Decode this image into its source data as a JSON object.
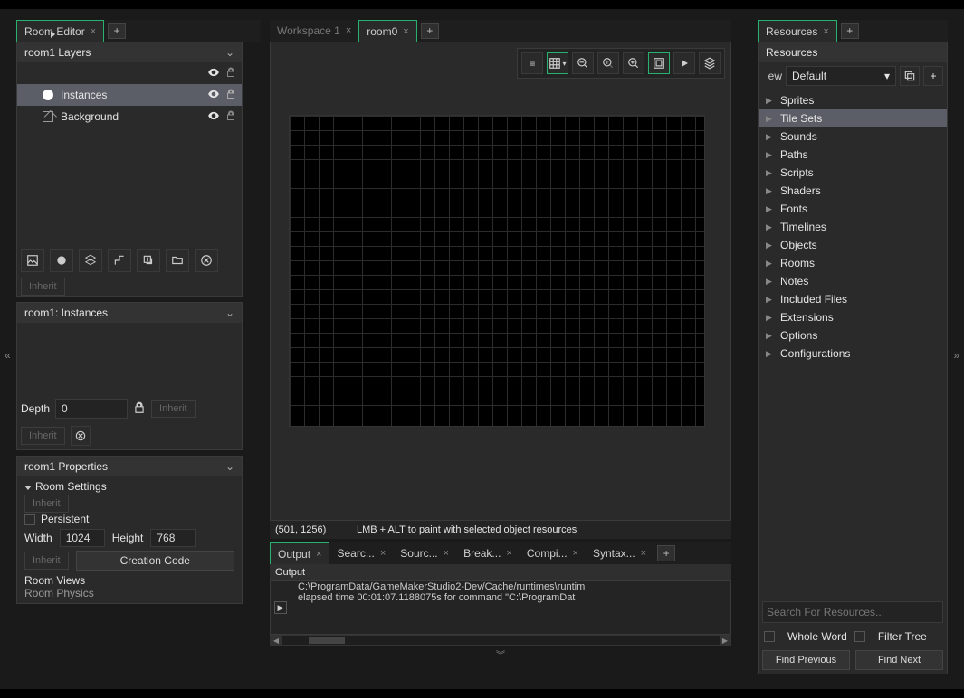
{
  "left": {
    "tab": "Room Editor",
    "layers_header": "room1 Layers",
    "layers": [
      {
        "label": "Instances",
        "selected": true
      },
      {
        "label": "Background",
        "selected": false
      }
    ],
    "inherit": "Inherit",
    "instances_header": "room1: Instances",
    "depth_label": "Depth",
    "depth_value": "0",
    "props_header": "room1 Properties",
    "room_settings": "Room Settings",
    "persistent": "Persistent",
    "width_label": "Width",
    "width_value": "1024",
    "height_label": "Height",
    "height_value": "768",
    "creation_code": "Creation Code",
    "room_views": "Room Views",
    "room_physics": "Room Physics"
  },
  "center": {
    "tabs": [
      {
        "label": "Workspace 1",
        "dim": true
      },
      {
        "label": "room0",
        "active": true
      }
    ],
    "coord": "(501, 1256)",
    "hint": "LMB + ALT to paint with selected object resources",
    "output_tabs": [
      {
        "label": "Output",
        "active": true
      },
      {
        "label": "Searc...",
        "active": false
      },
      {
        "label": "Sourc...",
        "active": false
      },
      {
        "label": "Break...",
        "active": false
      },
      {
        "label": "Compi...",
        "active": false
      },
      {
        "label": "Syntax...",
        "active": false
      }
    ],
    "output_title": "Output",
    "output_lines": [
      "C:\\ProgramData/GameMakerStudio2-Dev/Cache/runtimes\\runtim",
      "elapsed time 00:01:07.1188075s for command \"C:\\ProgramDat"
    ]
  },
  "right": {
    "tab": "Resources",
    "title": "Resources",
    "view_abbr": "ew",
    "selector": "Default",
    "tree": [
      {
        "label": "Sprites"
      },
      {
        "label": "Tile Sets",
        "selected": true
      },
      {
        "label": "Sounds"
      },
      {
        "label": "Paths"
      },
      {
        "label": "Scripts"
      },
      {
        "label": "Shaders"
      },
      {
        "label": "Fonts"
      },
      {
        "label": "Timelines"
      },
      {
        "label": "Objects"
      },
      {
        "label": "Rooms"
      },
      {
        "label": "Notes"
      },
      {
        "label": "Included Files"
      },
      {
        "label": "Extensions"
      },
      {
        "label": "Options"
      },
      {
        "label": "Configurations"
      }
    ],
    "search_placeholder": "Search For Resources...",
    "whole_word": "Whole Word",
    "filter_tree": "Filter Tree",
    "find_prev": "Find Previous",
    "find_next": "Find Next"
  },
  "collapse": {
    "left": "«",
    "right": "»",
    "down": "︾"
  }
}
